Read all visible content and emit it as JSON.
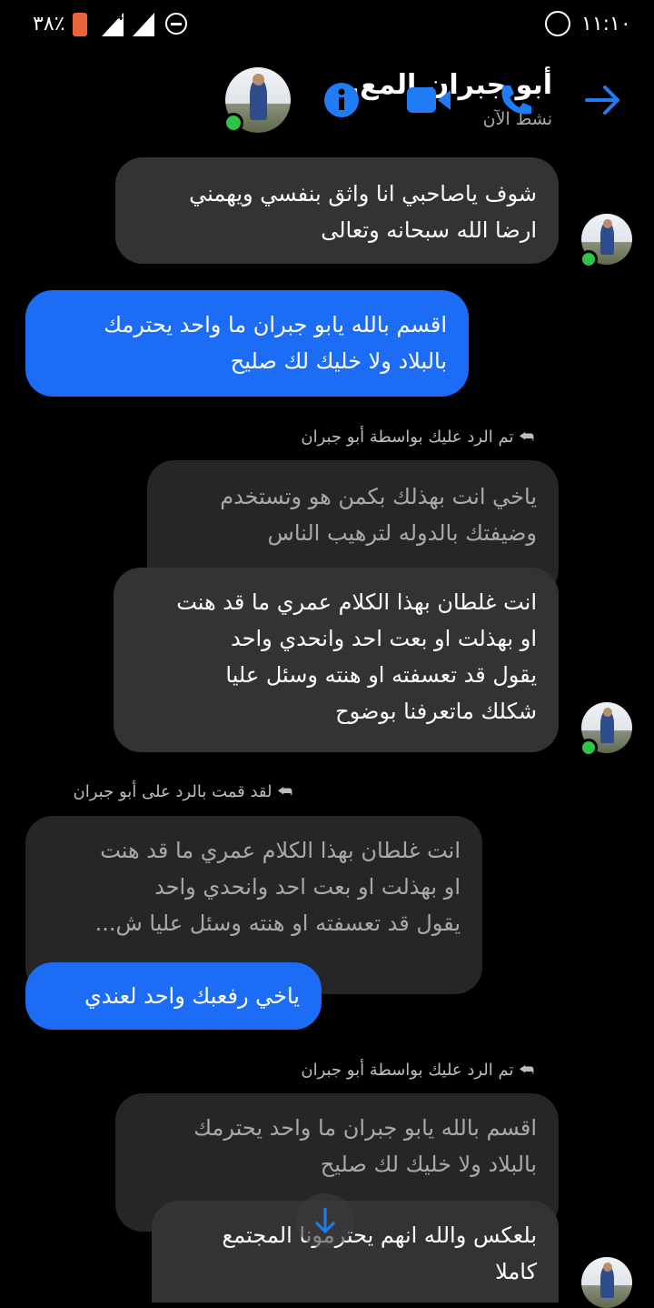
{
  "status_bar": {
    "battery": "٣٨٪",
    "network": "4G",
    "time": "١١:١٠"
  },
  "header": {
    "contact_name": "أبو جبران المع...",
    "presence": "نشط الآن"
  },
  "messages": {
    "m1": [
      "شوف ياصاحبي انا واثق بنفسي ويهمني",
      "ارضا الله سبحانه وتعالى"
    ],
    "m2": [
      "اقسم بالله يابو جبران ما واحد يحترمك",
      "بالبلاد ولا خليك لك صليح"
    ],
    "reply_label_1": "تم الرد عليك بواسطة أبو جبران",
    "m3_quoted": [
      "ياخي انت بهذلك بكمن هو وتستخدم",
      "وضيفتك بالدوله لترهيب الناس"
    ],
    "m3": [
      "انت غلطان بهذا الكلام عمري ما قد هنت",
      "او بهذلت او بعت  احد وانحدي واحد",
      "يقول قد تعسفته او هنته وسئل عليا",
      "شكلك ماتعرفنا بوضوح"
    ],
    "reply_label_2": "لقد قمت بالرد على أبو جبران",
    "m4_quoted": [
      "انت غلطان بهذا الكلام عمري ما قد هنت",
      "او بهذلت او بعت  احد وانحدي واحد",
      "يقول قد تعسفته او هنته وسئل عليا ش..."
    ],
    "m4": "ياخي رفعبك واحد لعندي",
    "reply_label_3": "تم الرد عليك بواسطة أبو جبران",
    "m5_quoted": [
      "اقسم بالله يابو جبران ما واحد يحترمك",
      "بالبلاد ولا خليك لك صليح"
    ],
    "m5": [
      "بلعكس والله انهم يحترمونا المجتمع",
      "كاملا"
    ]
  },
  "colors": {
    "accent": "#1f7cf5",
    "sent_bubble": "#1d6cf5",
    "received_bubble": "#333335",
    "online": "#31c24a"
  }
}
